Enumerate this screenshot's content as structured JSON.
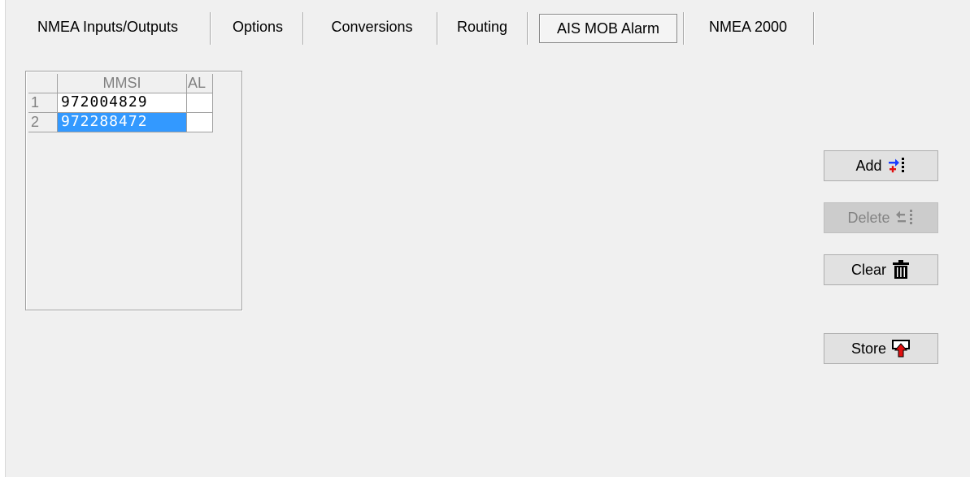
{
  "tabs": [
    {
      "label": "NMEA Inputs/Outputs",
      "active": false
    },
    {
      "label": "Options",
      "active": false
    },
    {
      "label": "Conversions",
      "active": false
    },
    {
      "label": "Routing",
      "active": false
    },
    {
      "label": "AIS MOB Alarm",
      "active": true
    },
    {
      "label": "NMEA 2000",
      "active": false
    }
  ],
  "grid": {
    "columns": [
      "MMSI",
      "AL"
    ],
    "rows": [
      {
        "index": "1",
        "mmsi": "972004829",
        "al": "",
        "selected": false
      },
      {
        "index": "2",
        "mmsi": "972288472",
        "al": "",
        "selected": true
      }
    ]
  },
  "buttons": {
    "add": {
      "label": "Add",
      "icon": "add-row-icon",
      "enabled": true
    },
    "delete": {
      "label": "Delete",
      "icon": "delete-row-icon",
      "enabled": false
    },
    "clear": {
      "label": "Clear",
      "icon": "trash-icon",
      "enabled": true
    },
    "store": {
      "label": "Store",
      "icon": "store-icon",
      "enabled": true
    }
  },
  "colors": {
    "selection": "#3399ff",
    "add_icon_blue": "#1a3cff",
    "add_icon_red": "#e01010",
    "store_icon_red": "#e01010"
  }
}
